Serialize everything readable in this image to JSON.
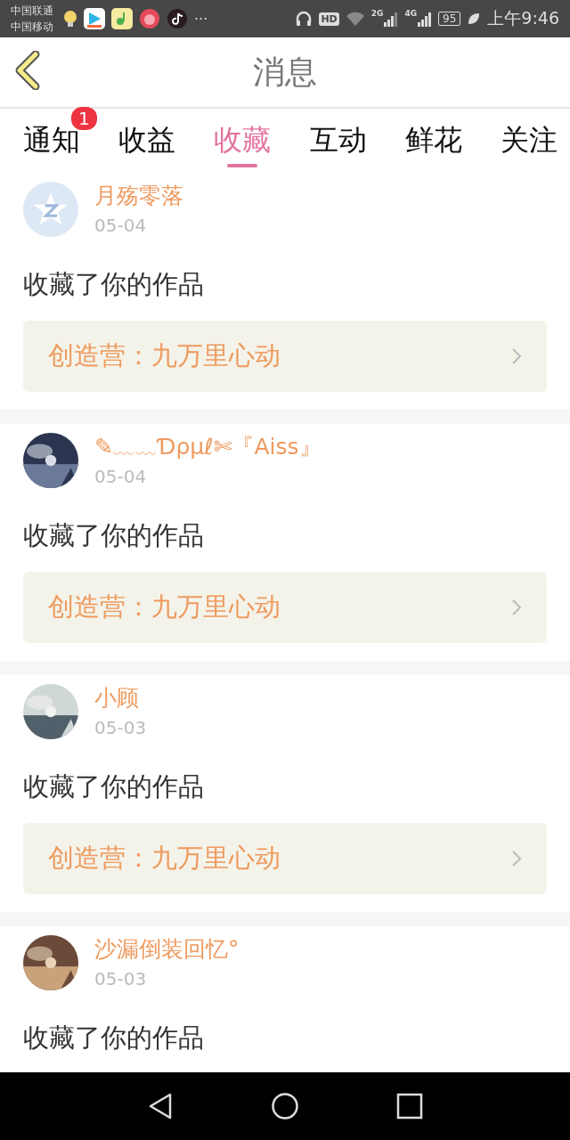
{
  "status_bar": {
    "carriers": [
      "中国联通",
      "中国移动"
    ],
    "more": "···",
    "hd": "HD",
    "network_2g": "2G",
    "network_4g": "4G",
    "battery": "95",
    "time": "上午9:46"
  },
  "header": {
    "title": "消息"
  },
  "tabs": [
    {
      "label": "通知",
      "selected": false,
      "badge": "1"
    },
    {
      "label": "收益",
      "selected": false
    },
    {
      "label": "收藏",
      "selected": true
    },
    {
      "label": "互动",
      "selected": false
    },
    {
      "label": "鲜花",
      "selected": false
    },
    {
      "label": "关注",
      "selected": false
    }
  ],
  "messages": [
    {
      "avatar": {
        "kind": "default"
      },
      "user": "月殇零落",
      "date": "05-04",
      "text": "收藏了你的作品",
      "work": "创造营：九万里心动"
    },
    {
      "user": "✎﹏﹏Ɗρμℓ✄『Aiss』",
      "date": "05-04",
      "text": "收藏了你的作品",
      "work": "创造营：九万里心动"
    },
    {
      "user": "小顾",
      "date": "05-03",
      "text": "收藏了你的作品",
      "work": "创造营：九万里心动"
    },
    {
      "user": "沙漏倒装回忆°",
      "date": "05-03",
      "text": "收藏了你的作品"
    }
  ]
}
